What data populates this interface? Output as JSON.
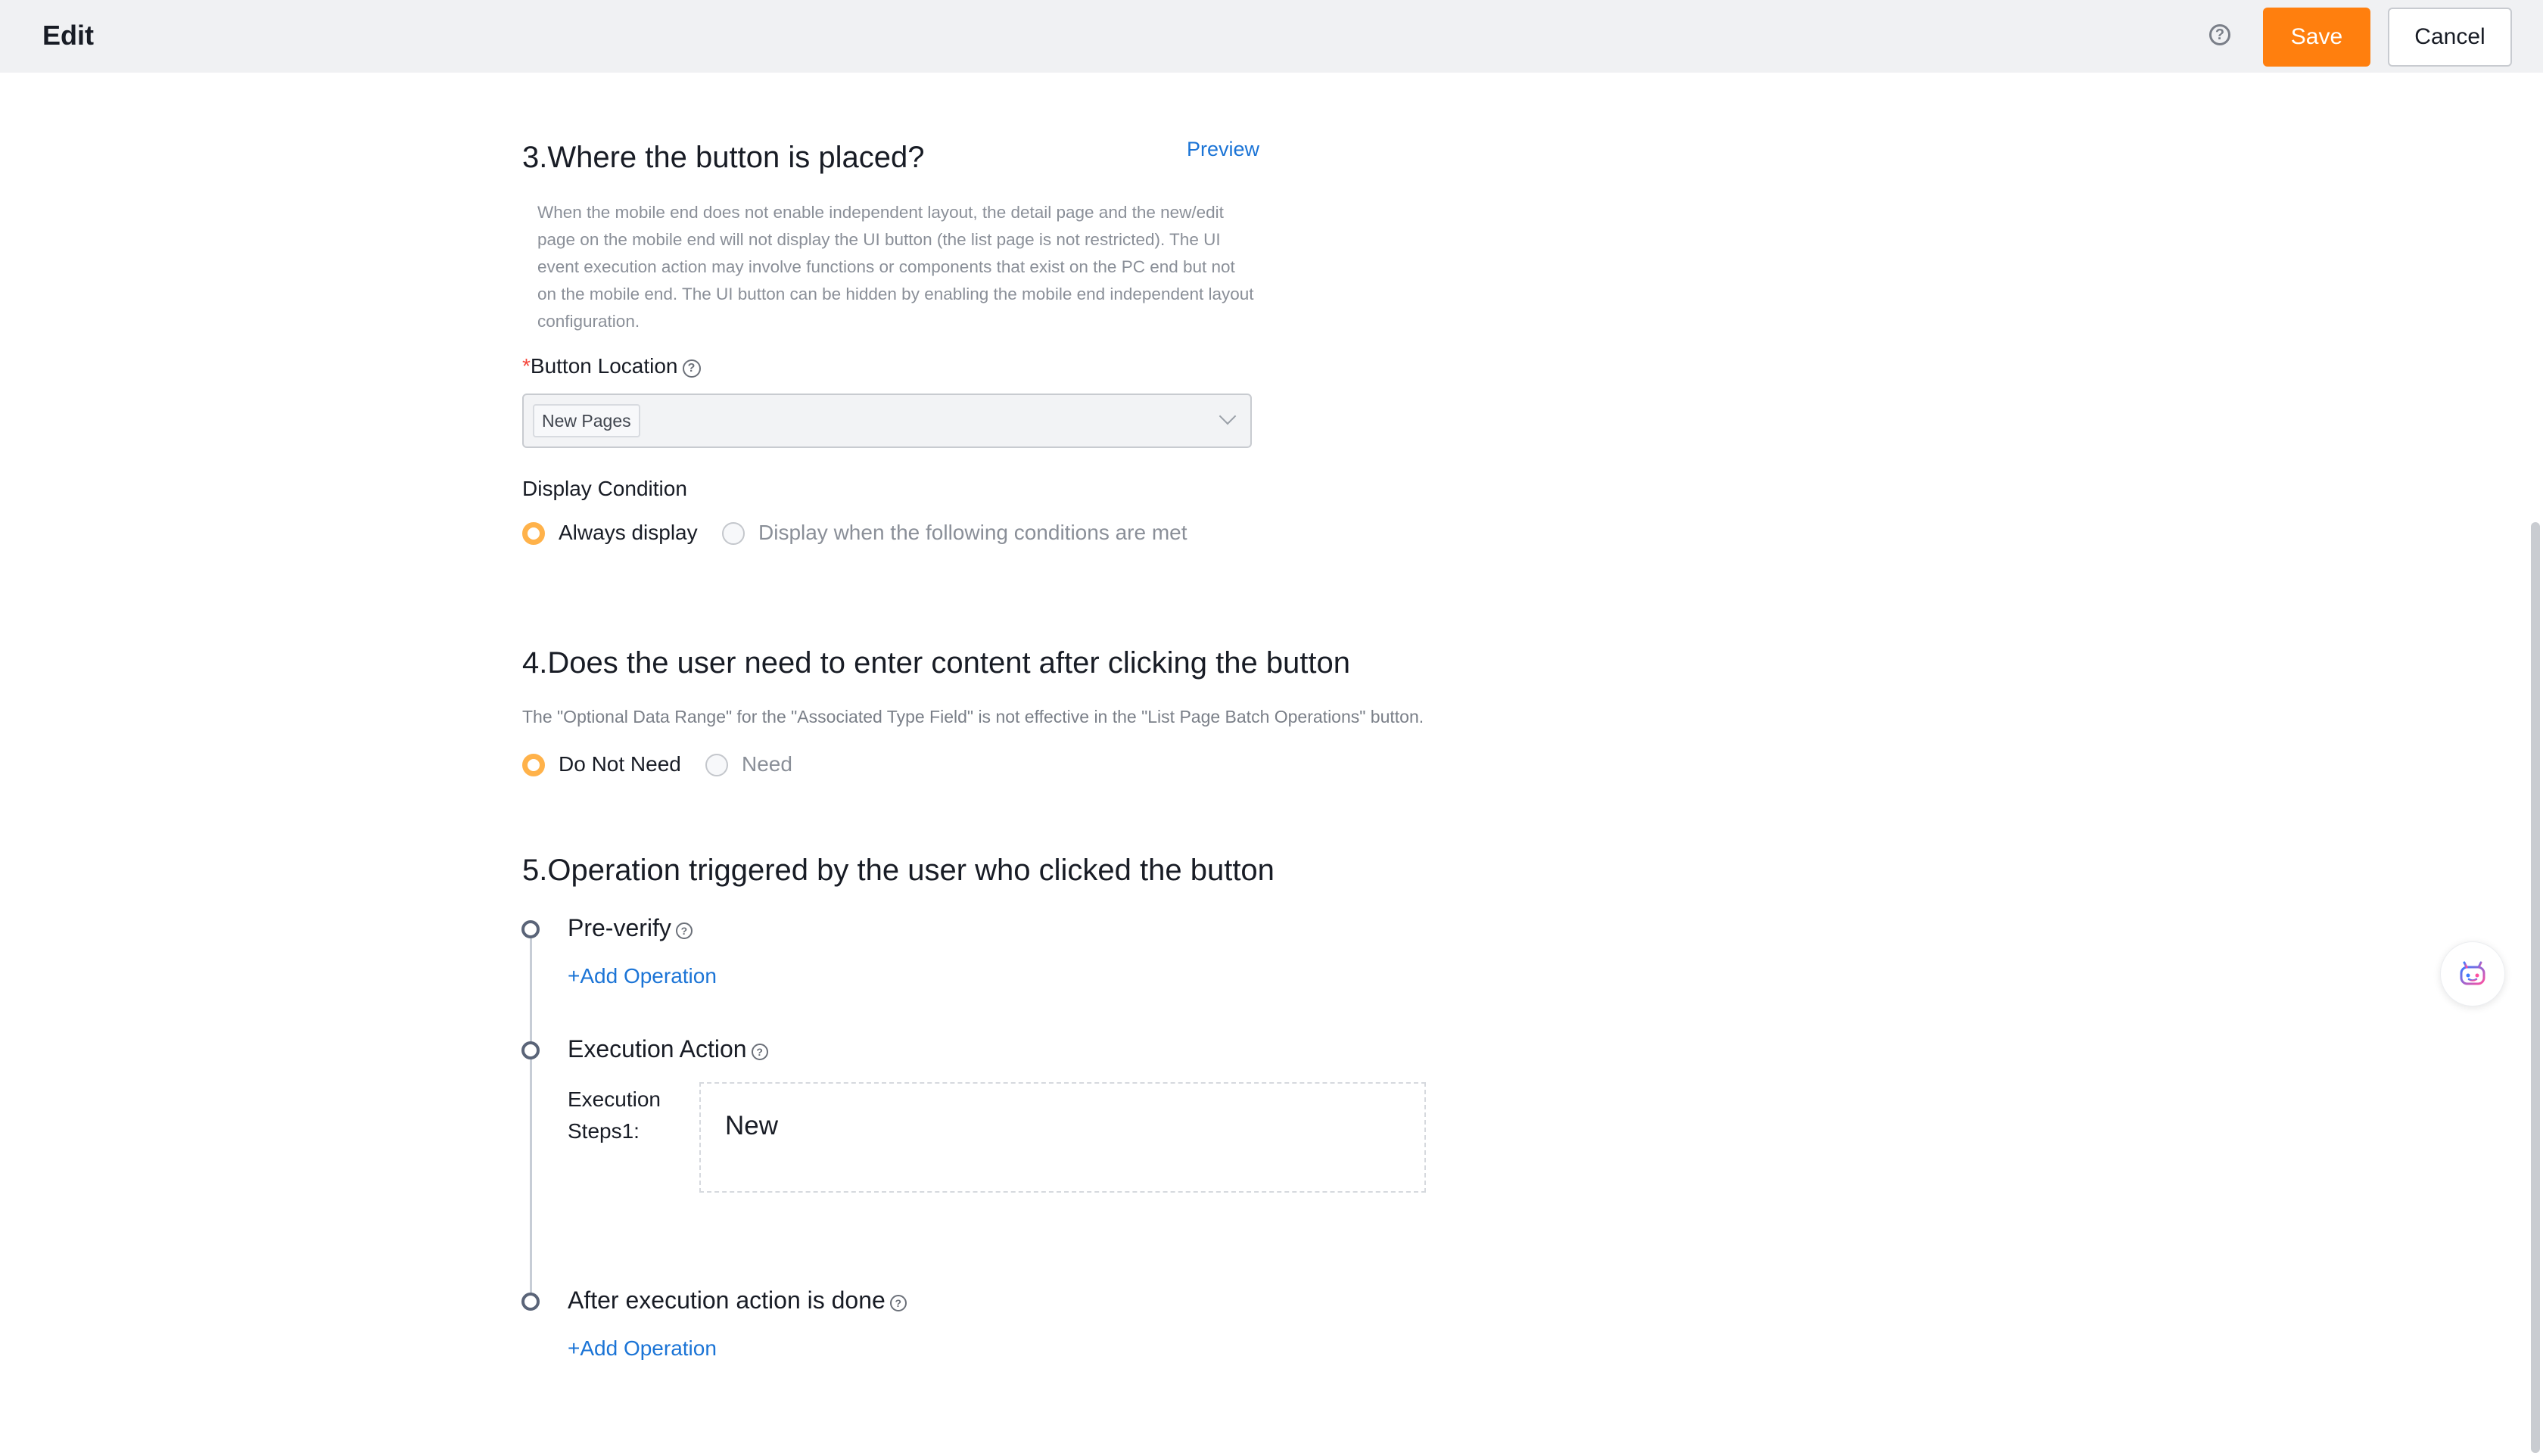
{
  "header": {
    "title": "Edit",
    "help_icon": "question-circle-icon",
    "save_label": "Save",
    "cancel_label": "Cancel"
  },
  "section3": {
    "title": "3.Where the button is placed?",
    "preview_label": "Preview",
    "note": "When the mobile end does not enable independent layout, the detail page and the new/edit page on the mobile end will not display the UI button (the list page is not restricted). The UI event execution action may involve functions or components that exist on the PC end but not on the mobile end. The UI button can be hidden by enabling the mobile end independent layout configuration.",
    "location_required_mark": "*",
    "location_label": "Button Location",
    "location_value": "New Pages",
    "display_condition_label": "Display Condition",
    "display_options": [
      {
        "label": "Always display",
        "selected": true
      },
      {
        "label": "Display when the following conditions are met",
        "selected": false
      }
    ]
  },
  "section4": {
    "title": "4.Does the user need to enter content after clicking the button",
    "note": "The \"Optional Data Range\" for the \"Associated Type Field\" is not effective in the \"List Page Batch Operations\" button.",
    "options": [
      {
        "label": "Do Not Need",
        "selected": true
      },
      {
        "label": "Need",
        "selected": false
      }
    ]
  },
  "section5": {
    "title": "5.Operation triggered by the user who clicked the button",
    "pre_verify_label": "Pre-verify",
    "add_operation_label": "+Add Operation",
    "execution_action_label": "Execution Action",
    "execution_step_label": "Execution Steps1:",
    "execution_step_value": "New",
    "after_execution_label": "After execution action is done",
    "add_operation_after_label": "+Add Operation"
  },
  "floating_assistant": {
    "icon": "robot-assistant-icon"
  },
  "colors": {
    "accent": "#ff7f0e",
    "link": "#1b74d6",
    "radio_selected": "#ffb24a",
    "required": "#f5463b"
  }
}
